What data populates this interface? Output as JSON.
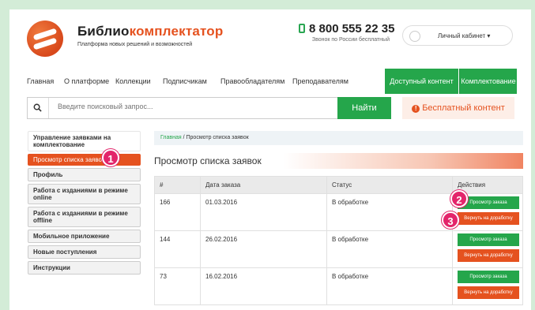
{
  "brand": {
    "name_main": "Библио",
    "name_accent": "комплектатор",
    "tagline": "Платформа новых решений и возможностей"
  },
  "contact": {
    "phone": "8 800 555 22 35",
    "phone_note": "Звонок по России бесплатный"
  },
  "account": {
    "label": "Личный кабинет ▾"
  },
  "nav": {
    "items": [
      "Главная",
      "О платформе",
      "Коллекции",
      "Подписчикам",
      "Правообладателям",
      "Преподавателям"
    ],
    "green": [
      "Доступный контент",
      "Комплектование"
    ]
  },
  "search": {
    "placeholder": "Введите поисковый запрос...",
    "button": "Найти",
    "free_label": "Бесплатный контент"
  },
  "sidebar": {
    "items": [
      "Управление заявками на комплектование",
      "Просмотр списка заявок",
      "Профиль",
      "Работа с изданиями в режиме online",
      "Работа с изданиями в режиме offline",
      "Мобильное приложение",
      "Новые поступления",
      "Инструкции"
    ]
  },
  "badges": [
    "1",
    "2",
    "3"
  ],
  "breadcrumb": {
    "home": "Главная",
    "sep": " / ",
    "current": "Просмотр списка заявок"
  },
  "page_title": "Просмотр списка заявок",
  "table": {
    "headers": [
      "#",
      "Дата заказа",
      "Статус",
      "Действия"
    ],
    "rows": [
      {
        "id": "166",
        "date": "01.03.2016",
        "status": "В обработке"
      },
      {
        "id": "144",
        "date": "26.02.2016",
        "status": "В обработке"
      },
      {
        "id": "73",
        "date": "16.02.2016",
        "status": "В обработке"
      }
    ],
    "view_label": "Просмотр заказа",
    "return_label": "Вернуть на доработку"
  },
  "colors": {
    "green": "#25a64b",
    "orange": "#e5521f",
    "badge": "#e3256b"
  }
}
